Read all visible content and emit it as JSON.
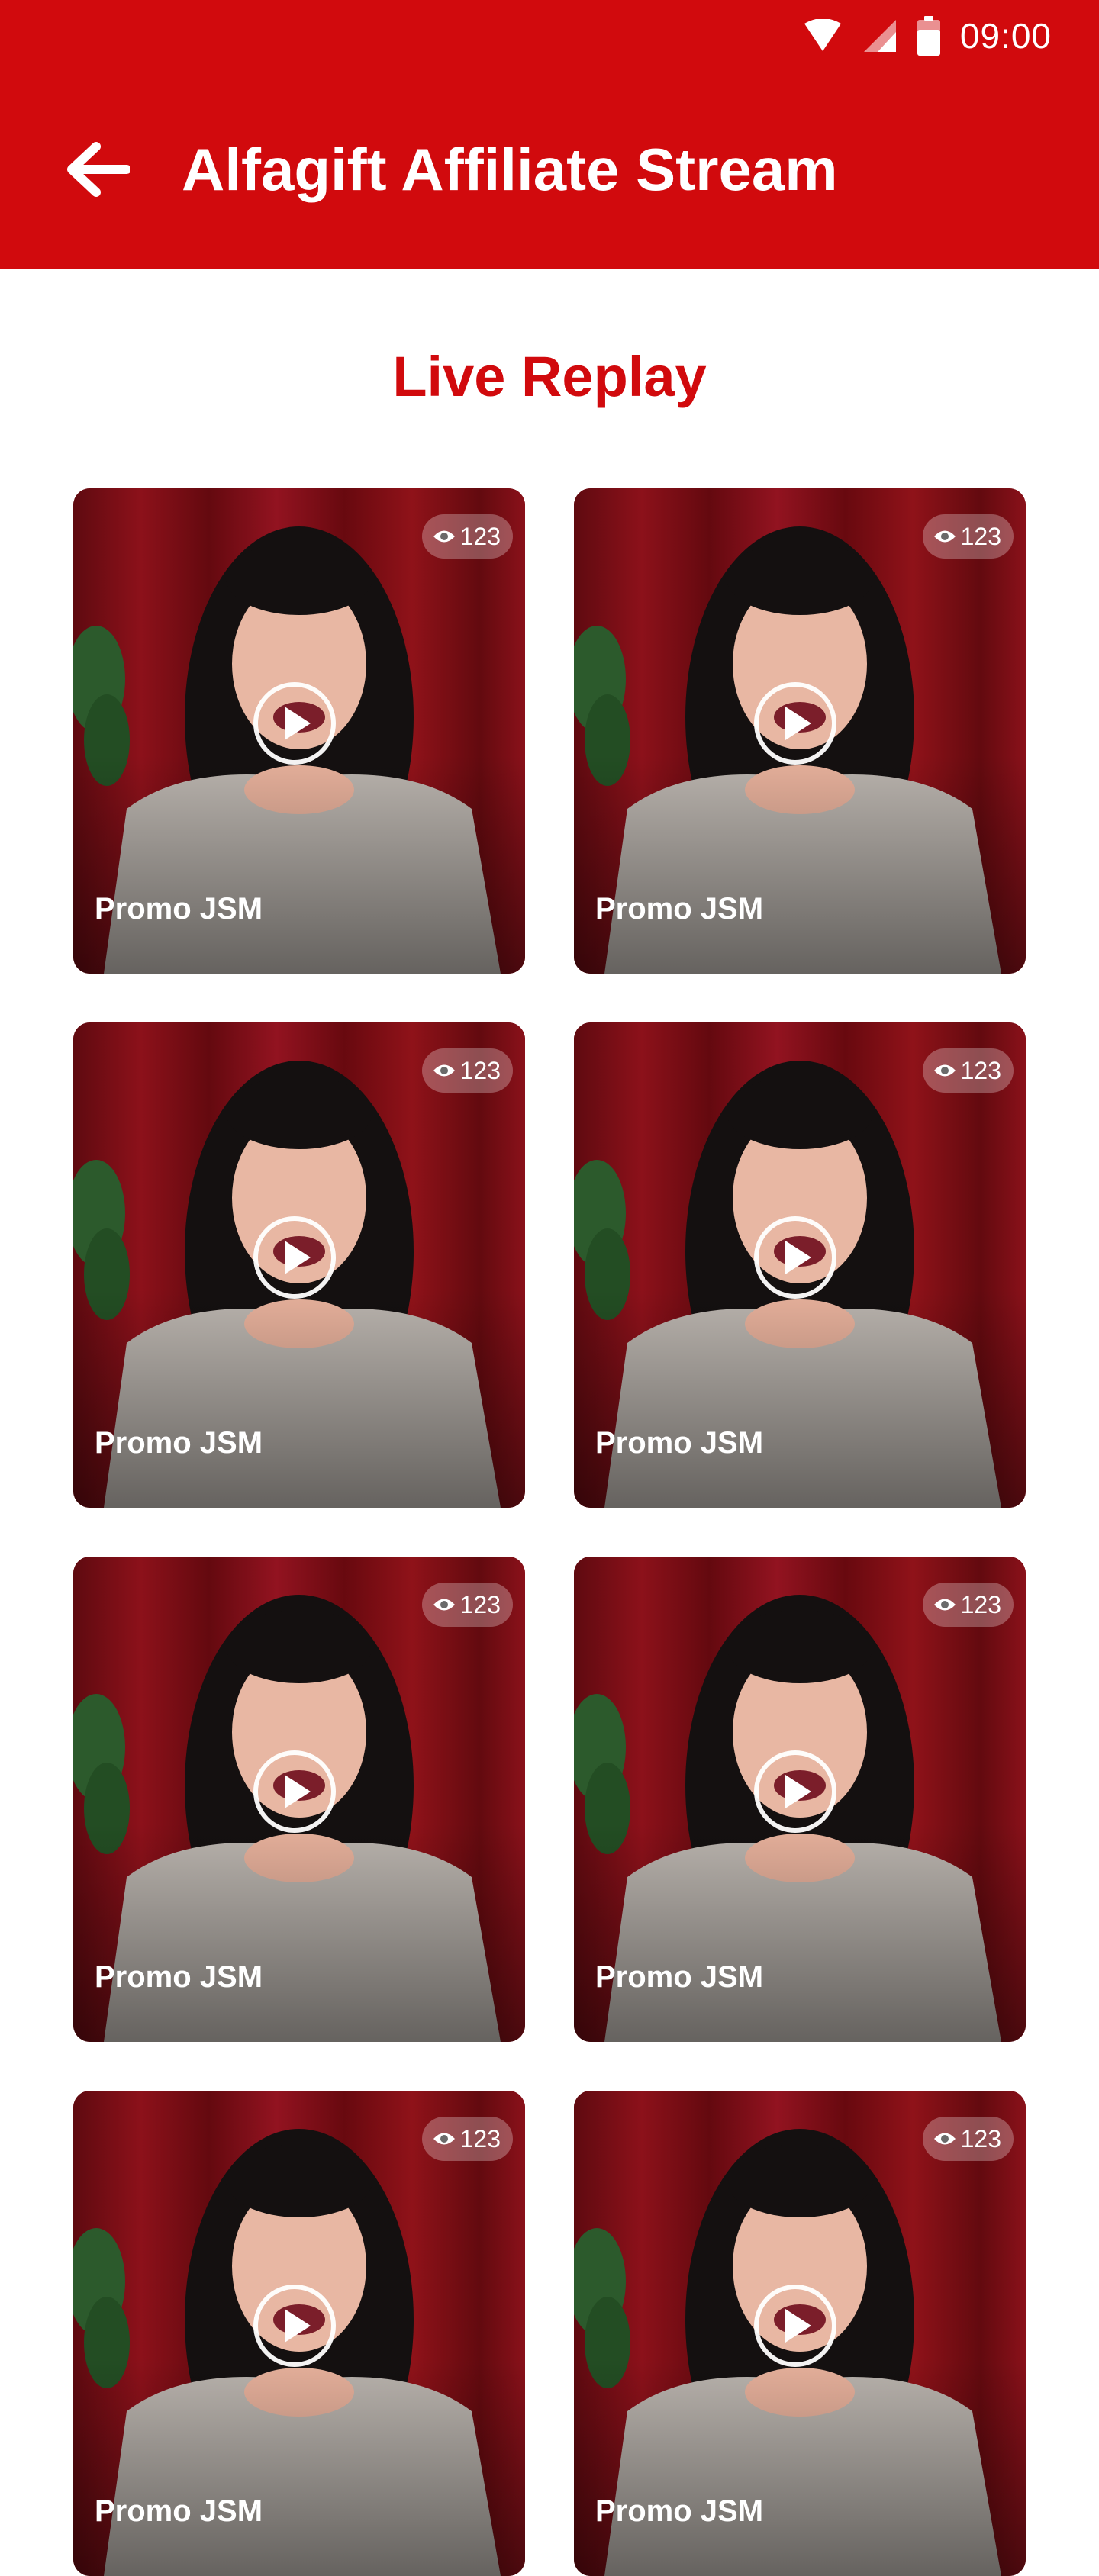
{
  "status_bar": {
    "time": "09:00"
  },
  "header": {
    "title": "Alfagift Affiliate Stream",
    "back_icon": "arrow-left-icon"
  },
  "section": {
    "title": "Live Replay"
  },
  "videos": [
    {
      "title": "Promo JSM",
      "views": "123"
    },
    {
      "title": "Promo JSM",
      "views": "123"
    },
    {
      "title": "Promo JSM",
      "views": "123"
    },
    {
      "title": "Promo JSM",
      "views": "123"
    },
    {
      "title": "Promo JSM",
      "views": "123"
    },
    {
      "title": "Promo JSM",
      "views": "123"
    },
    {
      "title": "Promo JSM",
      "views": "123"
    },
    {
      "title": "Promo JSM",
      "views": "123"
    }
  ],
  "colors": {
    "brand_red": "#D10A0D",
    "background": "#FFFFFF"
  }
}
